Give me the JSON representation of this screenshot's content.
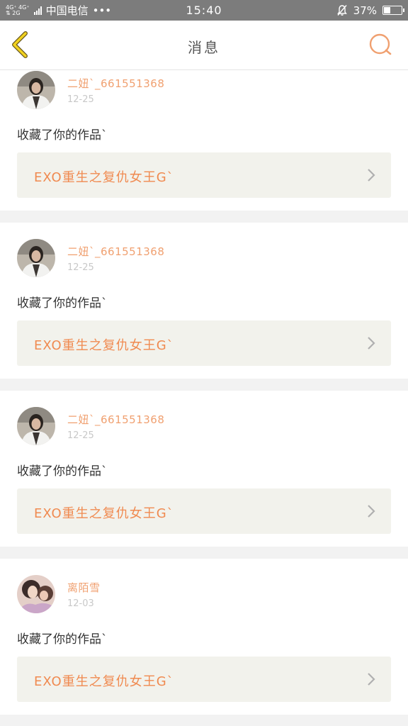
{
  "status_bar": {
    "network_top": "4G⁺ 4G⁺",
    "network_bottom": "⇅ 2G",
    "carrier": "中国电信",
    "dots": "•••",
    "time": "15:40",
    "battery_percent": "37%",
    "battery_level": 0.37
  },
  "header": {
    "title": "消息",
    "back_icon": "chevron-left-icon",
    "search_icon": "search-icon",
    "accent_color": "#f0a070"
  },
  "notifications": [
    {
      "username": "二妞`_661551368",
      "date": "12-25",
      "action": "收藏了你的作品`",
      "work_title": "EXO重生之复仇女王G`"
    },
    {
      "username": "二妞`_661551368",
      "date": "12-25",
      "action": "收藏了你的作品`",
      "work_title": "EXO重生之复仇女王G`"
    },
    {
      "username": "二妞`_661551368",
      "date": "12-25",
      "action": "收藏了你的作品`",
      "work_title": "EXO重生之复仇女王G`"
    },
    {
      "username": "离陌雪",
      "date": "12-03",
      "action": "收藏了你的作品`",
      "work_title": "EXO重生之复仇女王G`"
    }
  ]
}
